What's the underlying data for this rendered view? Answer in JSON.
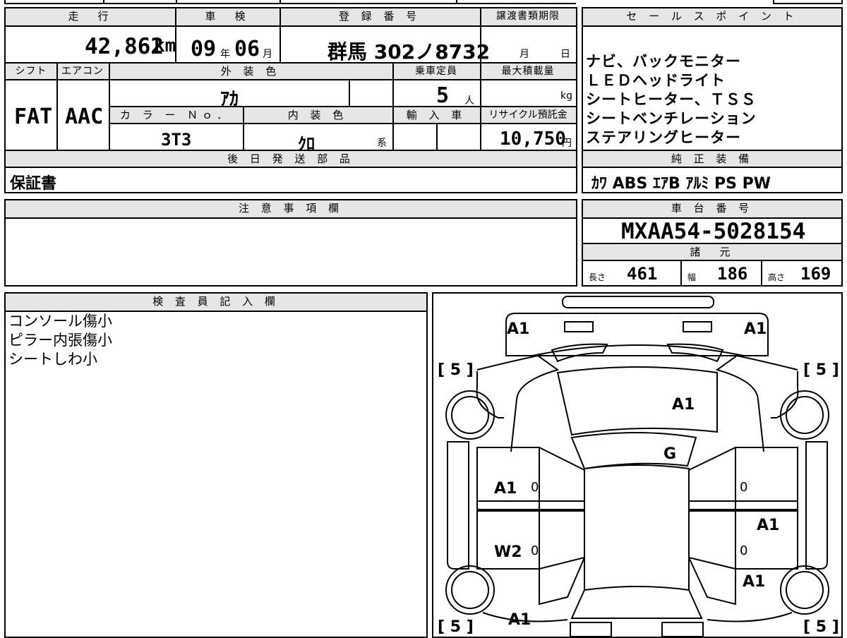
{
  "vehicle": {
    "mileage_header": "走　行",
    "mileage_value": "42,862",
    "mileage_unit": "km",
    "inspection_header": "車　検",
    "inspection_year": "09",
    "inspection_year_unit": "年",
    "inspection_month": "06",
    "inspection_month_unit": "月",
    "registration_header": "登 録 番 号",
    "registration_value": "群馬 302ノ8732",
    "transfer_header": "譲渡書類期限",
    "transfer_month_unit": "月",
    "transfer_day_unit": "日",
    "shift_header": "シフト",
    "shift_value": "FAT",
    "aircon_header": "エアコン",
    "aircon_value": "AAC",
    "exterior_header": "外 装 色",
    "exterior_value": "ｱｶ",
    "capacity_header": "乗車定員",
    "capacity_value": "5",
    "capacity_unit": "人",
    "load_header": "最大積載量",
    "load_unit": "kg",
    "color_no_header": "カ ラ ー Ｎｏ．",
    "color_no_value": "3T3",
    "interior_header": "内 装 色",
    "interior_value": "ｸﾛ",
    "interior_unit": "系",
    "import_header": "輸 入 車",
    "recycle_header": "リサイクル預託金",
    "recycle_value": "10,750",
    "recycle_unit": "円",
    "later_parts_header": "後 日 発 送 部 品",
    "later_parts_value": "保証書"
  },
  "sales": {
    "header": "セ ー ル ス ポ イ ン ト",
    "points": [
      "ナビ、バックモニター",
      "ＬＥＤヘッドライト",
      "シートヒーター、ＴＳＳ",
      "シートベンチレーション",
      "ステアリングヒーター"
    ]
  },
  "equipment": {
    "header": "純 正 装 備",
    "value": "ｶﾜ ABS ｴｱB ｱﾙﾐ PS PW"
  },
  "notice": {
    "header": "注 意 事 項 欄"
  },
  "chassis": {
    "header": "車 台 番 号",
    "value": "MXAA54-5028154"
  },
  "specs": {
    "header": "諸　元",
    "length_label": "長さ",
    "length_value": "461",
    "width_label": "幅",
    "width_value": "186",
    "height_label": "高さ",
    "height_value": "169"
  },
  "inspector": {
    "header": "検 査 員 記 入 欄",
    "notes": [
      "コンソール傷小",
      "ピラー内張傷小",
      "シートしわ小"
    ]
  },
  "diagram": {
    "front_left": "A1",
    "front_right": "A1",
    "bonnet": "A1",
    "windshield": "G",
    "left_front_door": "A1",
    "left_rear_door": "W2",
    "right_rear_door": "A1",
    "right_rear_quarter": "A1",
    "rear_left": "A1",
    "tire_fl": "5",
    "tire_fr": "5",
    "tire_rl": "5",
    "tire_rr": "5",
    "door_zero": "0",
    "bracket_open": "[",
    "bracket_close": "]"
  }
}
